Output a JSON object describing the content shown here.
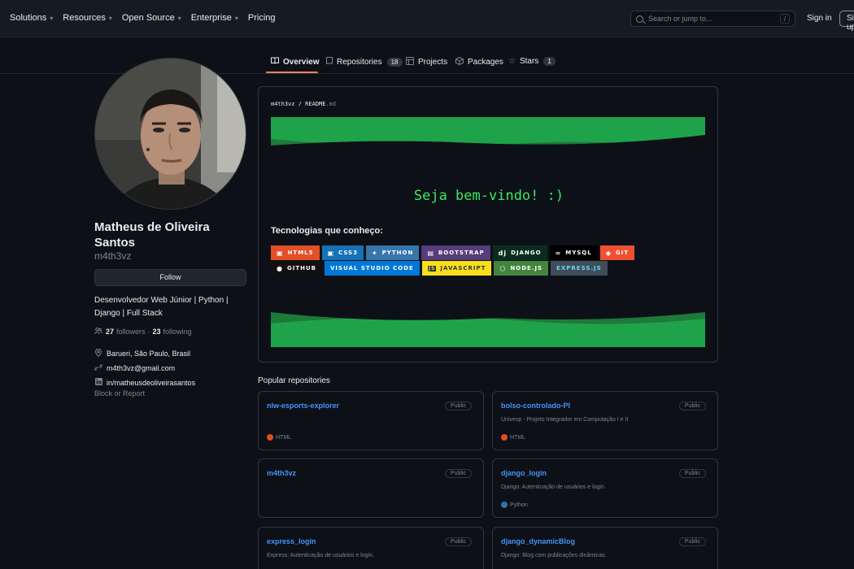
{
  "header": {
    "nav": [
      {
        "label": "Solutions",
        "dropdown": true
      },
      {
        "label": "Resources",
        "dropdown": true
      },
      {
        "label": "Open Source",
        "dropdown": true
      },
      {
        "label": "Enterprise",
        "dropdown": true
      },
      {
        "label": "Pricing",
        "dropdown": false
      }
    ],
    "search_placeholder": "Search or jump to...",
    "search_shortcut": "/",
    "sign_in": "Sign in",
    "sign_up": "Sign up"
  },
  "tabs": [
    {
      "label": "Overview",
      "icon": "book-icon",
      "active": true
    },
    {
      "label": "Repositories",
      "icon": "repo-icon",
      "count": "18"
    },
    {
      "label": "Projects",
      "icon": "table-icon"
    },
    {
      "label": "Packages",
      "icon": "package-icon"
    },
    {
      "label": "Stars",
      "icon": "star-icon",
      "count": "1"
    }
  ],
  "profile": {
    "name": "Matheus de Oliveira Santos",
    "username": "m4th3vz",
    "follow_label": "Follow",
    "bio": "Desenvolvedor Web Júnior | Python | Django | Full Stack",
    "followers_count": "27",
    "followers_label": "followers",
    "separator": "·",
    "following_count": "23",
    "following_label": "following",
    "location": "Barueri, São Paulo, Brasil",
    "email": "m4th3vz@gmail.com",
    "linkedin": "in/matheusdeoliveirasantos",
    "block_report": "Block or Report"
  },
  "readme": {
    "path_user": "m4th3vz",
    "path_sep": "/",
    "path_file": "README",
    "path_ext": ".md",
    "welcome": "Seja bem-vindo! :)",
    "tech_title": "Tecnologias que conheço:",
    "badges": [
      {
        "label": "HTML5",
        "bg": "#e34f26",
        "fg": "#ffffff",
        "icon": "html5-icon"
      },
      {
        "label": "CSS3",
        "bg": "#1572b6",
        "fg": "#ffffff",
        "icon": "css3-icon"
      },
      {
        "label": "PYTHON",
        "bg": "#3776ab",
        "fg": "#ffffff",
        "icon": "python-icon"
      },
      {
        "label": "BOOTSTRAP",
        "bg": "#563d7c",
        "fg": "#ffffff",
        "icon": "bootstrap-icon"
      },
      {
        "label": "DJANGO",
        "bg": "#092e20",
        "fg": "#ffffff",
        "icon": "django-icon"
      },
      {
        "label": "MYSQL",
        "bg": "#000000",
        "fg": "#ffffff",
        "icon": "mysql-icon"
      },
      {
        "label": "GIT",
        "bg": "#f05032",
        "fg": "#ffffff",
        "icon": "git-icon"
      },
      {
        "label": "GITHUB",
        "bg": "#121011",
        "fg": "#ffffff",
        "icon": "github-icon"
      },
      {
        "label": "VISUAL STUDIO CODE",
        "bg": "#0078d7",
        "fg": "#ffffff",
        "icon": ""
      },
      {
        "label": "JAVASCRIPT",
        "bg": "#f7df1e",
        "fg": "#323330",
        "icon": "javascript-icon"
      },
      {
        "label": "NODE.JS",
        "bg": "#43853d",
        "fg": "#ffffff",
        "icon": "nodejs-icon"
      },
      {
        "label": "EXPRESS.JS",
        "bg": "#404d59",
        "fg": "#61dafb",
        "icon": ""
      }
    ]
  },
  "popular_title": "Popular repositories",
  "repos": [
    {
      "name": "nlw-esports-explorer",
      "visibility": "Public",
      "description": "",
      "language": "HTML",
      "lang_color": "#e34c26"
    },
    {
      "name": "bolso-controlado-PI",
      "visibility": "Public",
      "description": "Univesp - Projeto Integrador em Computação I e II",
      "language": "HTML",
      "lang_color": "#e34c26"
    },
    {
      "name": "m4th3vz",
      "visibility": "Public",
      "description": "",
      "language": "",
      "lang_color": ""
    },
    {
      "name": "django_login",
      "visibility": "Public",
      "description": "Django: Autenticação de usuários e login.",
      "language": "Python",
      "lang_color": "#3572a5"
    },
    {
      "name": "express_login",
      "visibility": "Public",
      "description": "Express: Autenticação de usuários e login.",
      "language": "",
      "lang_color": ""
    },
    {
      "name": "django_dynamicBlog",
      "visibility": "Public",
      "description": "Django: Blog com publicações dinâmicas.",
      "language": "",
      "lang_color": ""
    }
  ],
  "colors": {
    "wave_dark": "#1d7a3a",
    "wave_light": "#1fa34a",
    "welcome_text": "#3ee85f",
    "link": "#4493f8",
    "tab_underline": "#f78166"
  }
}
